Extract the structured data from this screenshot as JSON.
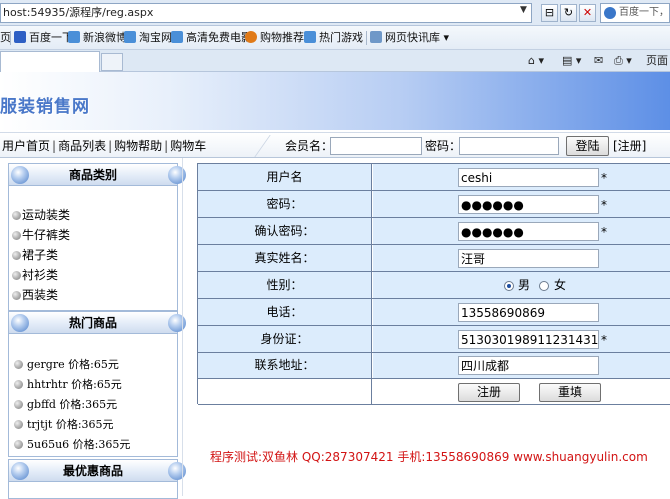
{
  "browser": {
    "address": "host:54935/源程序/reg.aspx",
    "search_engine_label": "百度一下，你",
    "favorites": [
      {
        "label": "页",
        "color": "#3a6ab0"
      },
      {
        "label": "百度一下",
        "color": "#2e5fc4"
      },
      {
        "label": "新浪微博",
        "color": "#4a8fd8"
      },
      {
        "label": "淘宝网",
        "color": "#4a8fd8"
      },
      {
        "label": "高清免费电影",
        "color": "#4a8fd8"
      },
      {
        "label": "购物推荐",
        "color": "#e07a18"
      },
      {
        "label": "热门游戏",
        "color": "#4a8fd8"
      },
      {
        "label": "网页快讯库 ▾",
        "color": "#6f98c8"
      }
    ],
    "toolbar_right": "页面("
  },
  "site": {
    "logo": "服装销售网",
    "nav": [
      "用户首页",
      "商品列表",
      "购物帮助",
      "购物车"
    ],
    "login": {
      "member_label": "会员名：",
      "password_label": "密码：",
      "login_button": "登陆",
      "register_link": "[注册]"
    }
  },
  "sidebar": {
    "categories_title": "商品类别",
    "categories": [
      "运动装类",
      "牛仔裤类",
      "裙子类",
      "衬衫类",
      "西装类"
    ],
    "hot_title": "热门商品",
    "hot_items": [
      "gergre 价格:65元",
      "hhtrhtr 价格:65元",
      "gbffd 价格:365元",
      "trjtjt 价格:365元",
      "5u65u6 价格:365元"
    ],
    "deals_title": "最优惠商品"
  },
  "form": {
    "fields": {
      "username": {
        "label": "用户名",
        "value": "ceshi",
        "required": "*"
      },
      "password": {
        "label": "密码：",
        "value": "●●●●●●",
        "required": "*"
      },
      "confirm": {
        "label": "确认密码：",
        "value": "●●●●●●",
        "required": "*"
      },
      "realname": {
        "label": "真实姓名：",
        "value": "汪哥"
      },
      "gender": {
        "label": "性别：",
        "male": "男",
        "female": "女",
        "selected": "男"
      },
      "phone": {
        "label": "电话：",
        "value": "13558690869"
      },
      "idcard": {
        "label": "身份证：",
        "value": "513030198911231431",
        "required": "*"
      },
      "address": {
        "label": "联系地址：",
        "value": "四川成都"
      }
    },
    "submit": "注册",
    "reset": "重填"
  },
  "footer": "程序测试:双鱼林 QQ:287307421 手机:13558690869 www.shuangyulin.com"
}
